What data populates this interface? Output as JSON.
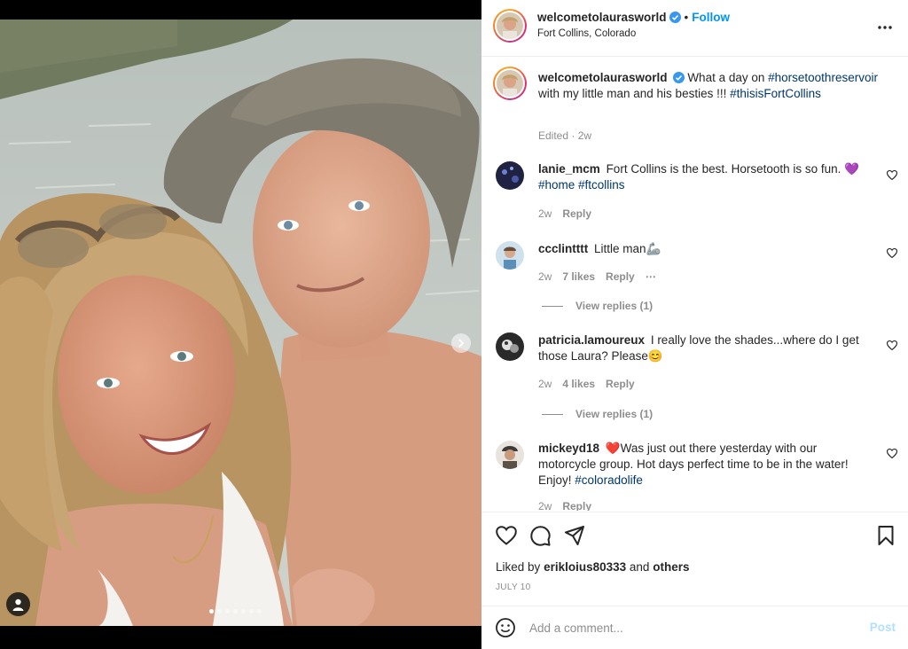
{
  "post": {
    "author": "welcometolaurasworld",
    "follow_label": "Follow",
    "location": "Fort Collins, Colorado",
    "more_icon": "more-horizontal-icon",
    "verified_icon": "verified-badge-icon",
    "carousel": {
      "slides": 7,
      "active_index": 0
    }
  },
  "caption": {
    "username": "welcometolaurasworld",
    "text_1": "What a day on",
    "hashtag_1": "#horsetoothreservoir",
    "text_2": "with my little man and his besties !!!",
    "hashtag_2": "#thisisFortCollins",
    "edited": "Edited · 2w"
  },
  "comments": [
    {
      "username": "lanie_mcm",
      "text": "Fort Collins is the best. Horsetooth is so fun. 💜",
      "hashtags": "#home #ftcollins",
      "time": "2w",
      "likes": "",
      "reply": "Reply"
    },
    {
      "username": "ccclintttt",
      "text": "Little man🦾",
      "time": "2w",
      "likes": "7 likes",
      "reply": "Reply",
      "view_replies": "View replies (1)"
    },
    {
      "username": "patricia.lamoureux",
      "text": "I really love the shades...where do I get those Laura? Please😊",
      "time": "2w",
      "likes": "4 likes",
      "reply": "Reply",
      "view_replies": "View replies (1)"
    },
    {
      "username": "mickeyd18",
      "text_prefix": "❤️Was just out there yesterday with our motorcycle group. Hot days perfect time to be in the water! Enjoy!",
      "hashtag": "#coloradolife",
      "time": "2w",
      "reply": "Reply"
    }
  ],
  "actions": {
    "liked_prefix": "Liked by",
    "liked_user": "erikloius80333",
    "liked_and": "and",
    "liked_others": "others",
    "date": "JULY 10"
  },
  "add_comment": {
    "placeholder": "Add a comment...",
    "post_label": "Post"
  },
  "colors": {
    "link": "#0095f6",
    "hashtag": "#00376b",
    "muted": "#8e8e8e",
    "post_disabled": "#b2dffc"
  }
}
